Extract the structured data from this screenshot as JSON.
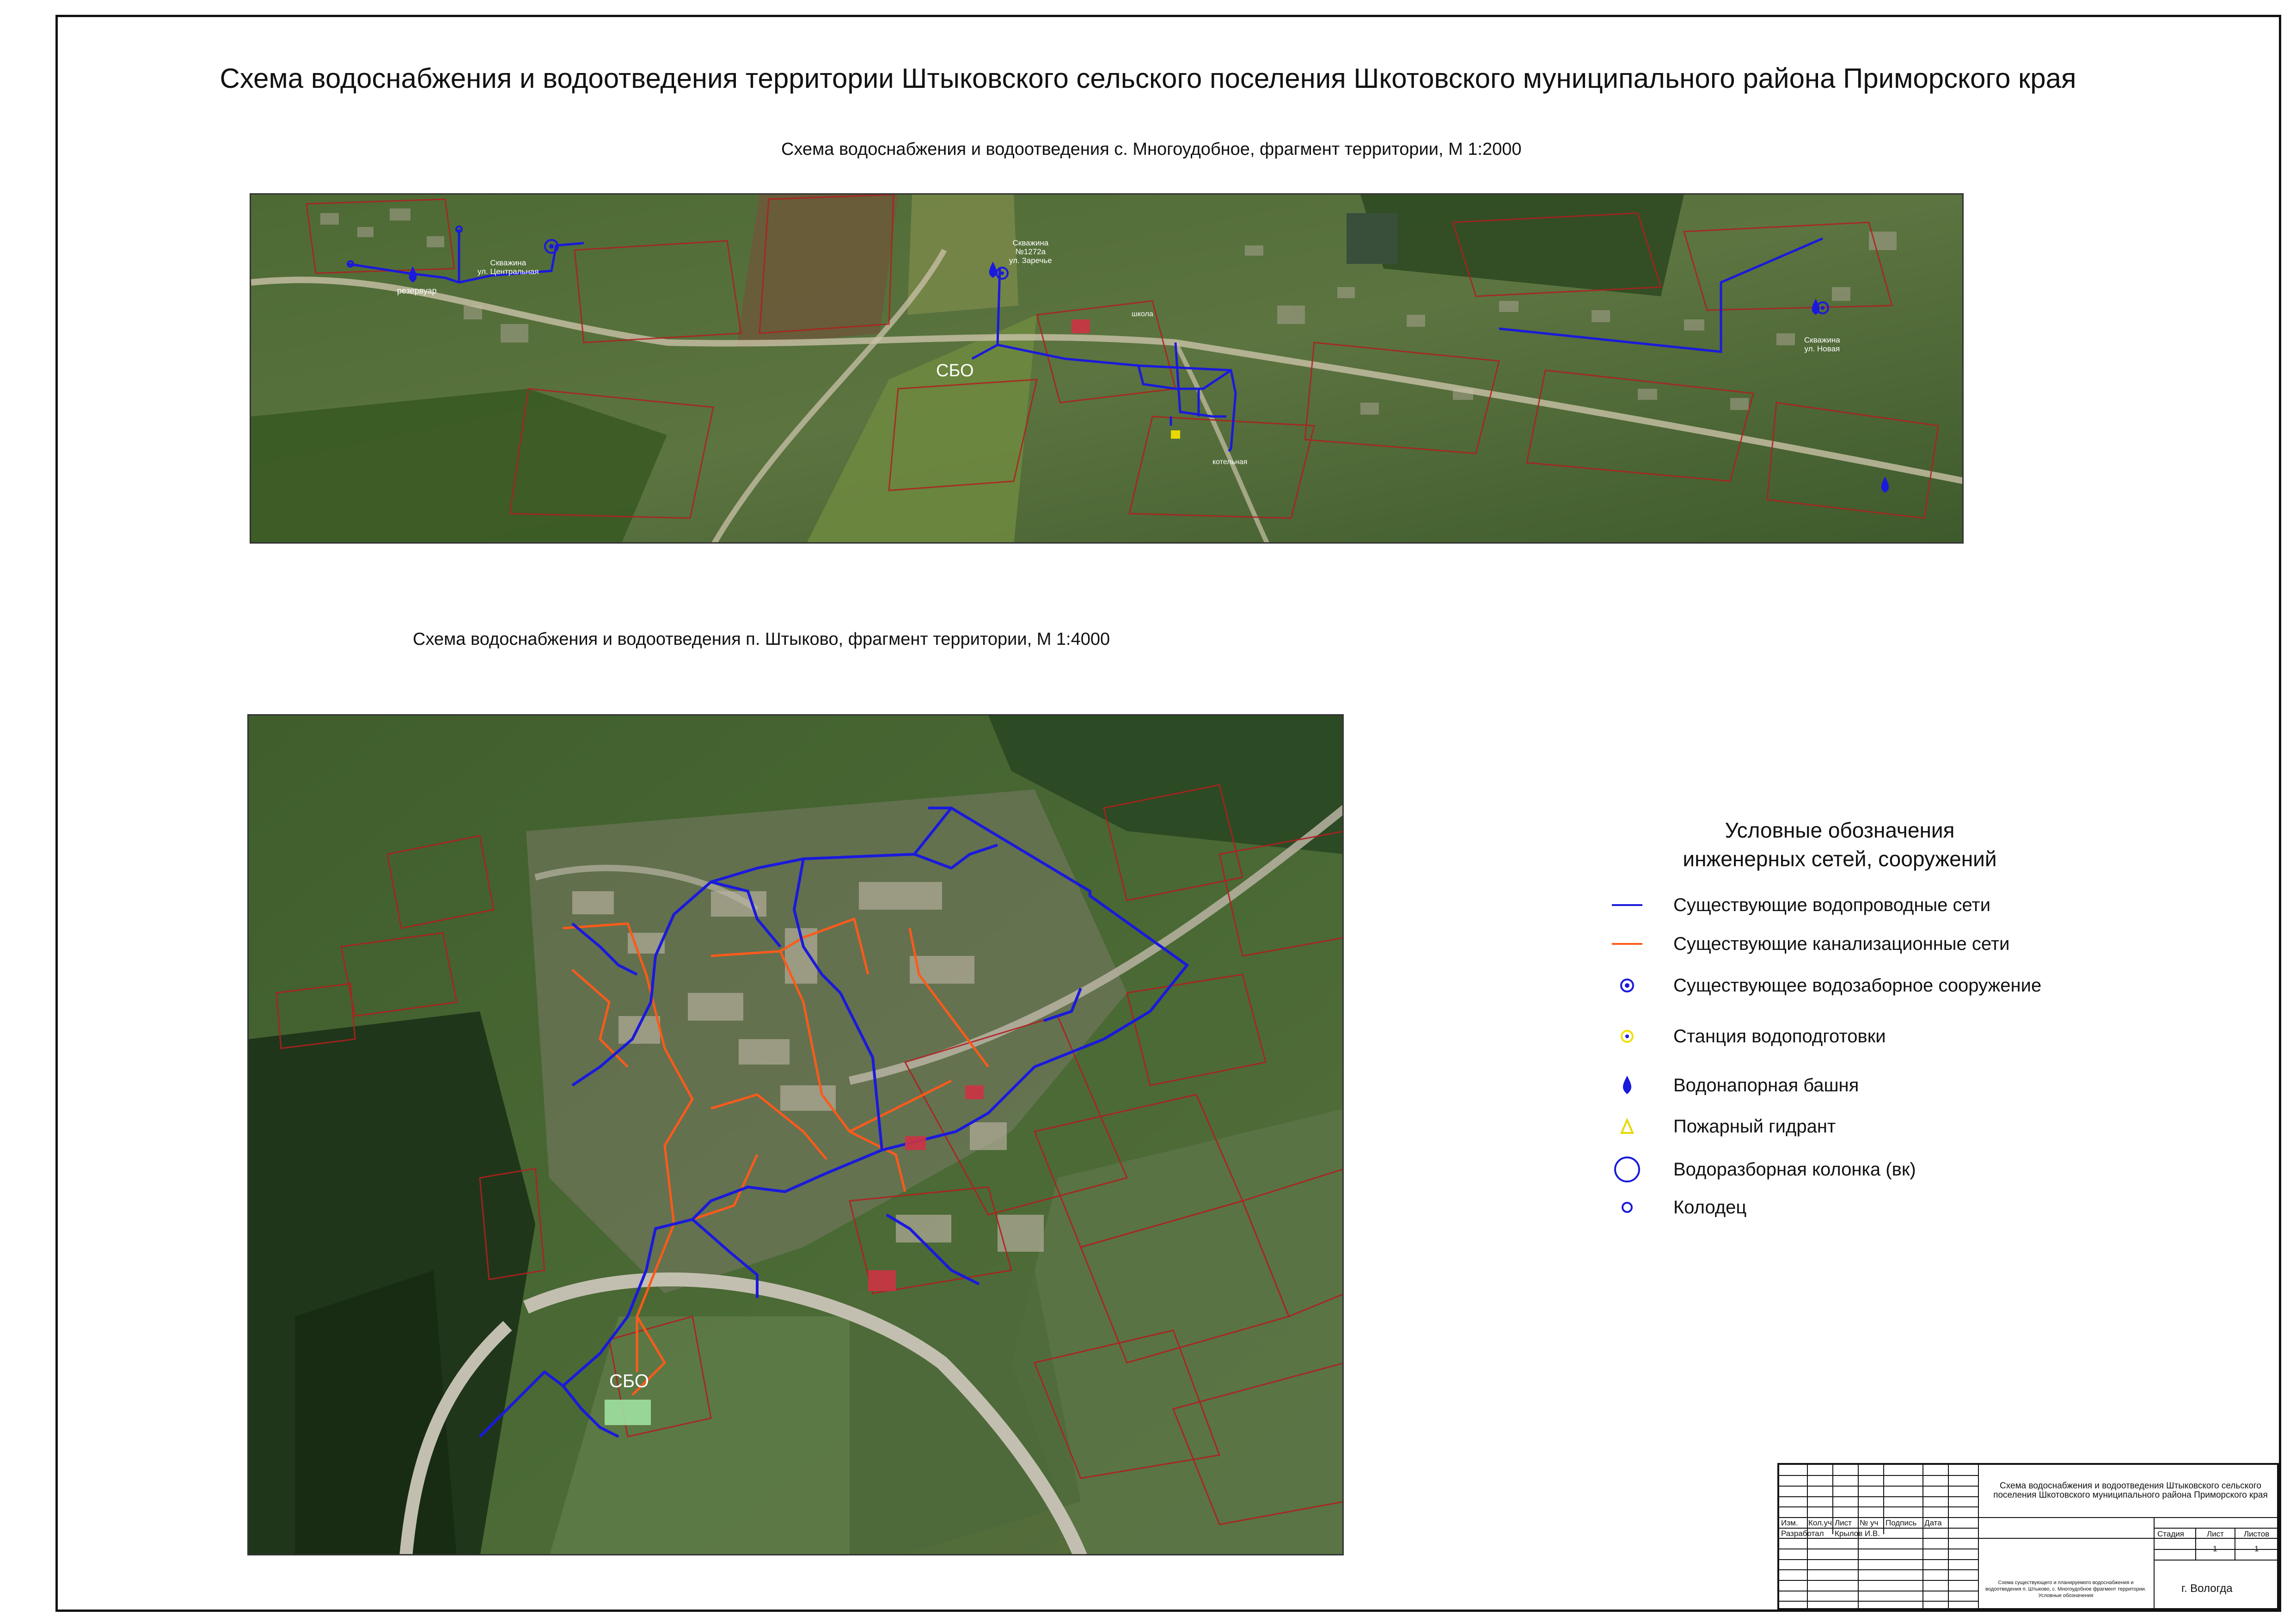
{
  "title": "Схема водоснабжения и водоотведения территории Штыковского сельского поселения Шкотовского муниципального района Приморского края",
  "map1": {
    "caption": "Схема водоснабжения и водоотведения с. Многоудобное, фрагмент территории, М 1:2000",
    "labels": {
      "reservoir": "резервуар",
      "well_central_1": "Скважина",
      "well_central_2": "ул. Центральная",
      "well_zarechye_1": "Скважина",
      "well_zarechye_2": "№1272а",
      "well_zarechye_3": "ул. Заречье",
      "sbo": "СБО",
      "well_new_1": "Скважина",
      "well_new_2": "ул. Новая",
      "school": "школа",
      "boiler": "котельная"
    }
  },
  "map2": {
    "caption": "Схема водоснабжения и водоотведения п. Штыково, фрагмент территории, М 1:4000",
    "labels": {
      "sbo": "СБО"
    }
  },
  "legend": {
    "title_line1": "Условные обозначения",
    "title_line2": "инженерных сетей, сооружений",
    "items": [
      {
        "label": "Существующие водопроводные сети",
        "icon": "blue-line-icon"
      },
      {
        "label": "Существующие канализационные сети",
        "icon": "orange-line-icon"
      },
      {
        "label": "Существующее водозаборное сооружение",
        "icon": "water-intake-icon"
      },
      {
        "label": "Станция водоподготовки",
        "icon": "treatment-station-icon"
      },
      {
        "label": "Водонапорная башня",
        "icon": "water-tower-icon"
      },
      {
        "label": "Пожарный гидрант",
        "icon": "fire-hydrant-icon"
      },
      {
        "label": "Водоразборная колонка (вк)",
        "icon": "standpipe-icon"
      },
      {
        "label": "Колодец",
        "icon": "well-icon"
      }
    ]
  },
  "stamp": {
    "headers": [
      "Изм.",
      "Кол.уч",
      "Лист",
      "№ уч",
      "Подпись",
      "Дата"
    ],
    "developed_label": "Разработал",
    "developer": "Крылов И.В.",
    "project_title": "Схема водоснабжения и водоотведения Штыковского сельского поселения Шкотовского муниципального района Приморского края",
    "stage_label": "Стадия",
    "sheet_label": "Лист",
    "sheets_label": "Листов",
    "sheet_value": "1",
    "sheets_value": "1",
    "sheet_desc": "Схема существующего и планируемого водоснабжения и водоотведения п. Штыково, с. Многоудобное фрагмент территории. Условные обозначения",
    "city": "г. Вологда"
  },
  "colors": {
    "water": "#1a1adc",
    "sewer": "#ff5a1a",
    "parcel": "#b01f1f",
    "hydrant": "#e8d800"
  }
}
